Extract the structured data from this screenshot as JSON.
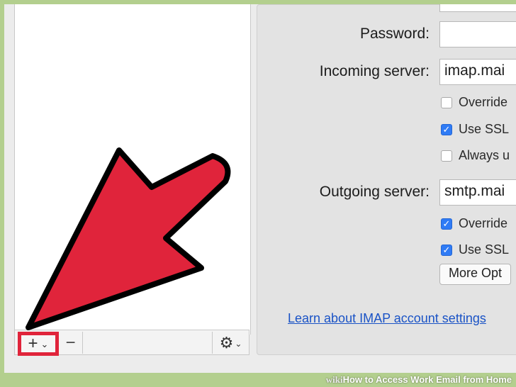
{
  "form": {
    "password_label": "Password:",
    "password_value": "",
    "incoming_label": "Incoming server:",
    "incoming_value": "imap.mai",
    "incoming_options": [
      {
        "label": "Override",
        "checked": false
      },
      {
        "label": "Use SSL",
        "checked": true
      },
      {
        "label": "Always u",
        "checked": false
      }
    ],
    "outgoing_label": "Outgoing server:",
    "outgoing_value": "smtp.mai",
    "outgoing_options": [
      {
        "label": "Override",
        "checked": true
      },
      {
        "label": "Use SSL",
        "checked": true
      }
    ],
    "more_options_label": "More Opt",
    "learn_link": "Learn about IMAP account settings"
  },
  "toolbar": {
    "add_glyph": "+",
    "remove_glyph": "−",
    "gear_glyph": "⚙",
    "chevron_glyph": "⌄"
  },
  "watermark": {
    "brand": "wiki",
    "title": "How to Access Work Email from Home"
  },
  "colors": {
    "arrow": "#e0243b",
    "checkbox_checked": "#2f7bf5",
    "link": "#1a53c6"
  }
}
